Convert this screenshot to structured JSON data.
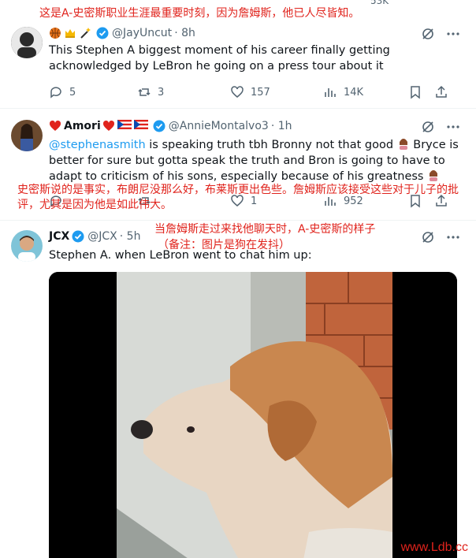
{
  "top_annotation": "这是A-史密斯职业生涯最重要时刻，因为詹姆斯，他已人尽皆知。",
  "top_partial_count": "53K",
  "tweets": [
    {
      "name": "",
      "handle": "@JayUncut",
      "time": "· 8h",
      "text": "This Stephen A biggest moment of his career finally getting acknowledged by LeBron he going on a press tour about it",
      "replies": "5",
      "reposts": "3",
      "likes": "157",
      "views": "14K"
    },
    {
      "name": "Amori",
      "handle": "@AnnieMontalvo3",
      "time": "· 1h",
      "mention": "@stephenasmith",
      "text1": " is speaking truth tbh Bronny not that good ",
      "text1b": " Bryce is better for sure but gotta speak the truth and Bron is going to  have to adapt to criticism of his sons, especially because of his greatness ",
      "replies": "",
      "reposts": "",
      "likes": "1",
      "views": "952",
      "annotation": "史密斯说的是事实，布朗尼没那么好，布莱斯更出色些。詹姆斯应该接受这些对于儿子的批评，尤其是因为他是如此伟大。"
    },
    {
      "name": "JCX",
      "handle": "@JCX",
      "time": "· 5h",
      "text": "Stephen A. when LeBron went to chat him up:",
      "annotation_line1": "当詹姆斯走过来找他聊天时，A-史密斯的样子",
      "annotation_line2": "（备注：图片是狗在发抖）"
    }
  ],
  "watermark": "www.Ldb.cc",
  "colors": {
    "accent": "#1d9bf0",
    "annotation": "#e0231c",
    "muted": "#536471"
  }
}
